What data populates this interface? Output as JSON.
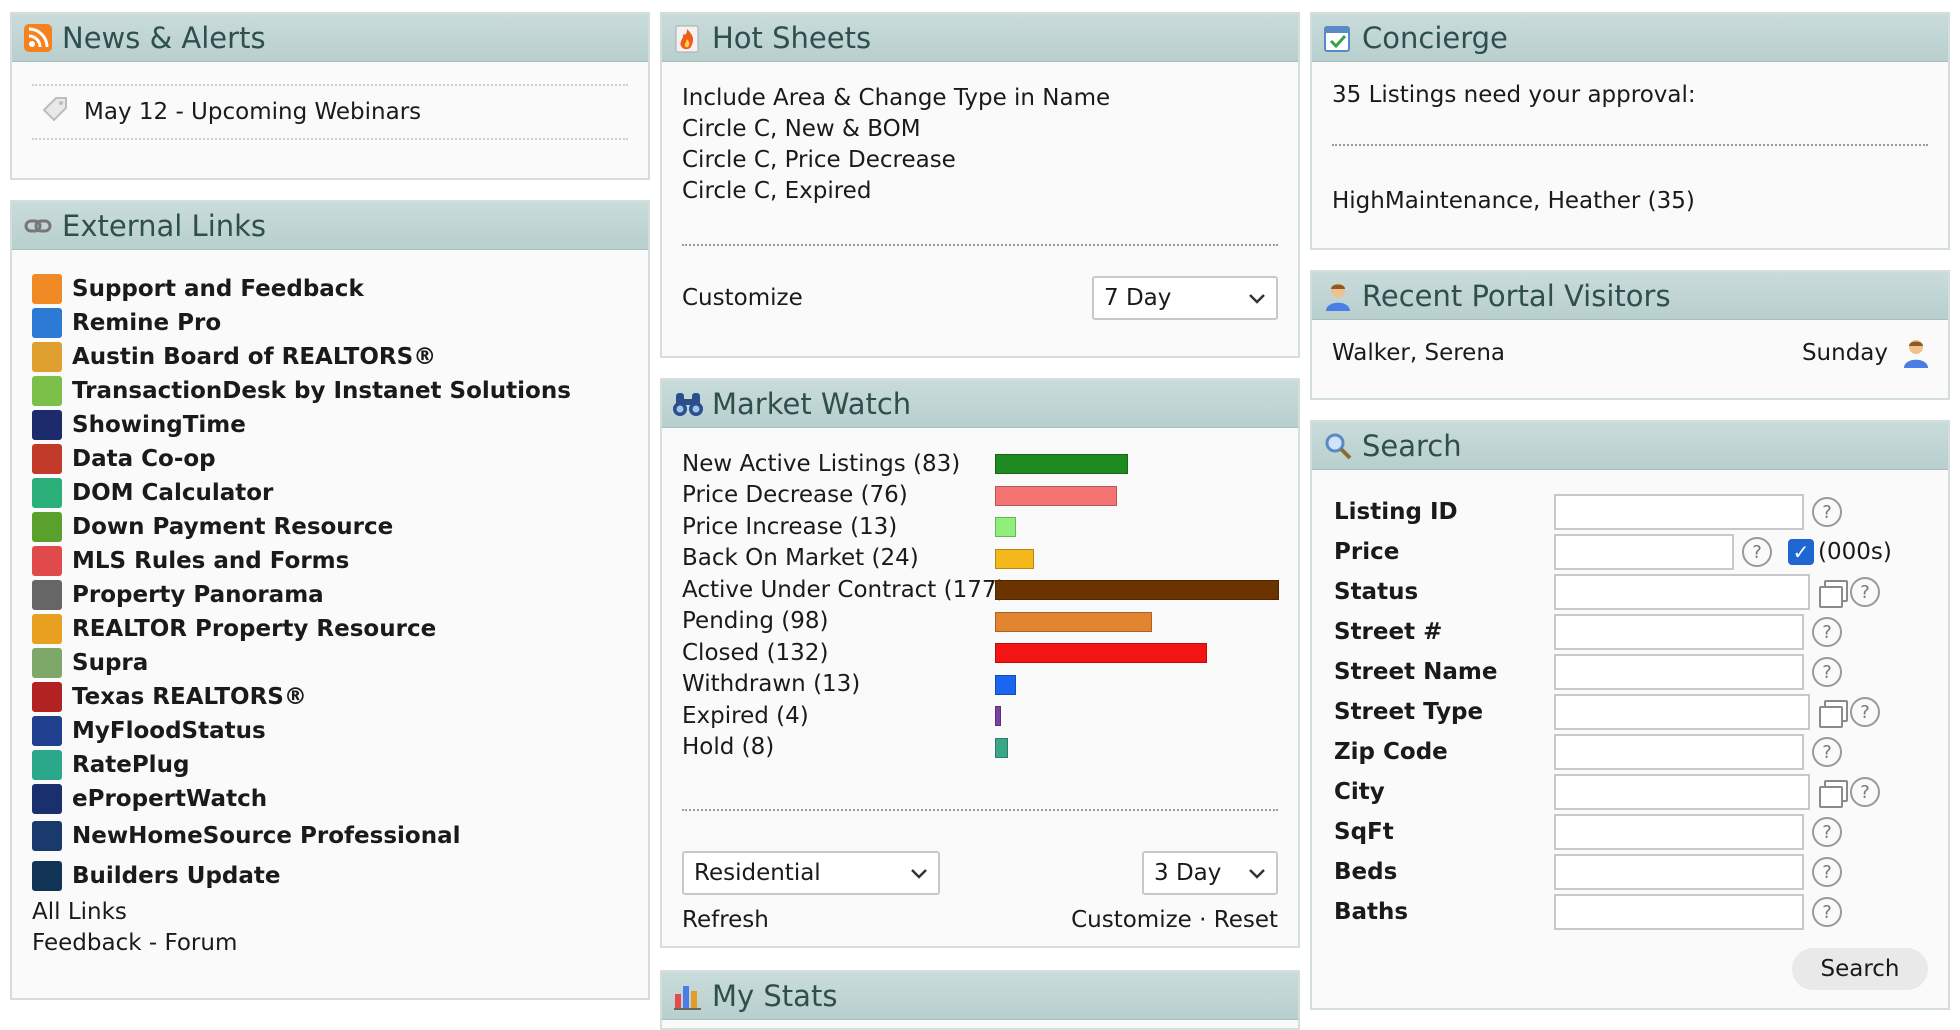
{
  "news": {
    "title": "News & Alerts",
    "items": [
      {
        "label": "May 12 - Upcoming Webinars"
      }
    ]
  },
  "external_links": {
    "title": "External Links",
    "items": [
      {
        "label": "Support and Feedback",
        "icon": "megaphone-icon",
        "color": "#f08a24"
      },
      {
        "label": "Remine Pro",
        "icon": "remine-icon",
        "color": "#2b7bd6"
      },
      {
        "label": "Austin Board of REALTORS®",
        "icon": "abor-icon",
        "color": "#e0a030"
      },
      {
        "label": "TransactionDesk by Instanet Solutions",
        "icon": "transactiondesk-icon",
        "color": "#7cc04a"
      },
      {
        "label": "ShowingTime",
        "icon": "showingtime-icon",
        "color": "#1d2a6b"
      },
      {
        "label": "Data Co-op",
        "icon": "datacoop-icon",
        "color": "#c23a2a"
      },
      {
        "label": "DOM Calculator",
        "icon": "calculator-icon",
        "color": "#2bb07a"
      },
      {
        "label": "Down Payment Resource",
        "icon": "dollar-icon",
        "color": "#5aa02c"
      },
      {
        "label": "MLS Rules and Forms",
        "icon": "checklist-icon",
        "color": "#e04a4a"
      },
      {
        "label": "Property Panorama",
        "icon": "panorama-icon",
        "color": "#666666"
      },
      {
        "label": "REALTOR Property Resource",
        "icon": "rpr-icon",
        "color": "#e8a020"
      },
      {
        "label": "Supra",
        "icon": "supra-icon",
        "color": "#7ea86a"
      },
      {
        "label": "Texas REALTORS®",
        "icon": "texas-realtors-icon",
        "color": "#b22222"
      },
      {
        "label": "MyFloodStatus",
        "icon": "flood-icon",
        "color": "#1f3f8f"
      },
      {
        "label": "RatePlug",
        "icon": "rateplug-icon",
        "color": "#2aa889"
      },
      {
        "label": "ePropertWatch",
        "icon": "epropertwatch-icon",
        "color": "#1a2f6e"
      },
      {
        "label": "NewHomeSource Professional",
        "icon": "newhomesource-icon",
        "color": "#1a3a6e"
      },
      {
        "label": "Builders Update",
        "icon": "builders-update-icon",
        "color": "#123456"
      }
    ],
    "all_links": "All Links",
    "feedback": "Feedback - Forum"
  },
  "hot_sheets": {
    "title": "Hot Sheets",
    "items": [
      "Include Area & Change Type in Name",
      "Circle C, New & BOM",
      "Circle C, Price Decrease",
      "Circle C, Expired"
    ],
    "customize": "Customize",
    "period": "7 Day"
  },
  "market_watch": {
    "title": "Market Watch",
    "rows": [
      {
        "label": "New Active Listings (83)",
        "value": 83,
        "color": "#1f8a1f"
      },
      {
        "label": "Price Decrease (76)",
        "value": 76,
        "color": "#f47474"
      },
      {
        "label": "Price Increase (13)",
        "value": 13,
        "color": "#8ef07a"
      },
      {
        "label": "Back On Market (24)",
        "value": 24,
        "color": "#f5b81c"
      },
      {
        "label": "Active Under Contract (177)",
        "value": 177,
        "color": "#6b3300"
      },
      {
        "label": "Pending (98)",
        "value": 98,
        "color": "#e38430"
      },
      {
        "label": "Closed (132)",
        "value": 132,
        "color": "#f51414"
      },
      {
        "label": "Withdrawn (13)",
        "value": 13,
        "color": "#1a66f0"
      },
      {
        "label": "Expired (4)",
        "value": 4,
        "color": "#7a40a0"
      },
      {
        "label": "Hold (8)",
        "value": 8,
        "color": "#3aa888"
      }
    ],
    "property_type": "Residential",
    "period": "3 Day",
    "refresh": "Refresh",
    "customize": "Customize",
    "separator": "·",
    "reset": "Reset"
  },
  "my_stats": {
    "title": "My Stats"
  },
  "concierge": {
    "title": "Concierge",
    "summary": "35 Listings need your approval:",
    "agent": "HighMaintenance, Heather (35)"
  },
  "visitors": {
    "title": "Recent Portal Visitors",
    "name": "Walker, Serena",
    "day": "Sunday"
  },
  "search": {
    "title": "Search",
    "fields": {
      "listing_id": "Listing ID",
      "price": "Price",
      "price_unit": "(000s)",
      "status": "Status",
      "street_num": "Street #",
      "street_name": "Street Name",
      "street_type": "Street Type",
      "zip": "Zip Code",
      "city": "City",
      "sqft": "SqFt",
      "beds": "Beds",
      "baths": "Baths"
    },
    "help": "?",
    "button": "Search"
  }
}
